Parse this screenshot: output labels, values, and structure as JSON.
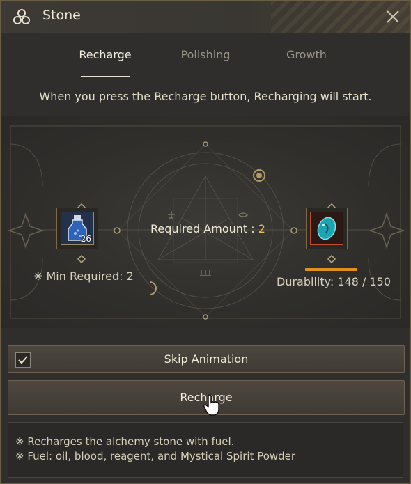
{
  "window": {
    "title": "Stone"
  },
  "tabs": [
    {
      "label": "Recharge",
      "active": true
    },
    {
      "label": "Polishing",
      "active": false
    },
    {
      "label": "Growth",
      "active": false
    }
  ],
  "instruction": "When you press the Recharge button, Recharging will start.",
  "recharge": {
    "required_label": "Required Amount : ",
    "required_value": "2",
    "fuel_count": "26",
    "min_required": "※ Min Required: 2",
    "durability": "Durability: 148 / 150",
    "durability_fraction": 0.987
  },
  "controls": {
    "skip_label": "Skip Animation",
    "skip_checked": true,
    "recharge_label": "Recharge"
  },
  "info": {
    "line1": "※ Recharges the alchemy stone with fuel.",
    "line2": "※ Fuel: oil, blood, reagent, and Mystical Spirit Powder"
  },
  "colors": {
    "accent": "#e6c14f",
    "durability_bar": "#e0901e",
    "frame": "#7b6a4a"
  },
  "icons": {
    "title": "triskele-icon",
    "close": "close-icon",
    "fuel": "fuel-bottle-icon",
    "stone": "alchemy-stone-icon",
    "check": "check-icon",
    "cursor": "hand-cursor-icon"
  }
}
